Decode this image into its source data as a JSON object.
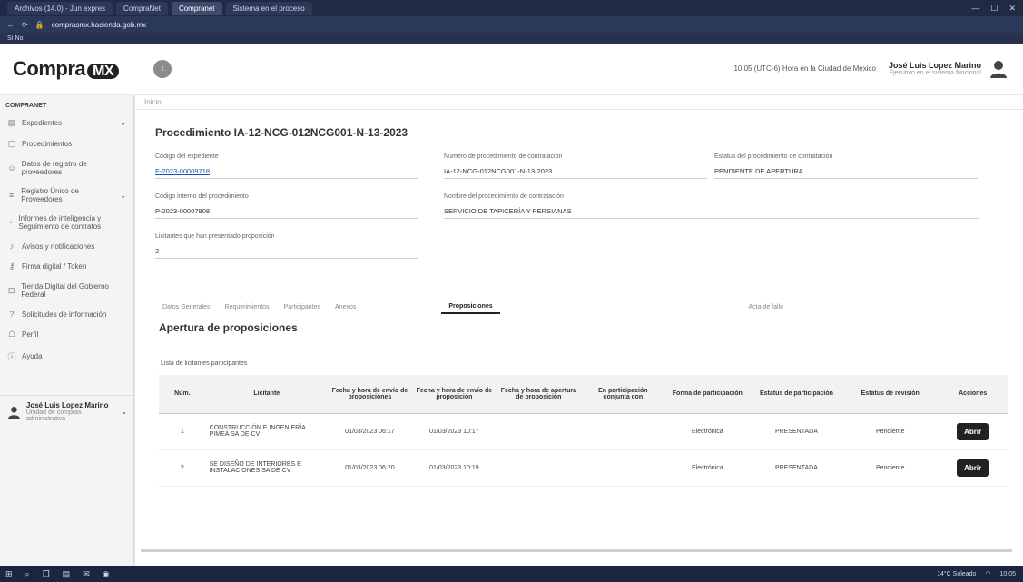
{
  "browser": {
    "tabs": [
      "Archivos (14.0) - Jun expres",
      "CompraNet",
      "Compranet",
      "Sistema en el proceso"
    ],
    "url": "comprasmx.hacienda.gob.mx",
    "bookmarks": "Sí No"
  },
  "header": {
    "logo_text": "Compra",
    "logo_badge": "MX",
    "time_notice": "10:05 (UTC-6) Hora en la Ciudad de México",
    "user_name": "José Luis Lopez Marino",
    "user_role": "Ejecutivo en el sistema funcional"
  },
  "sidebar": {
    "section": "COMPRANET",
    "items": [
      {
        "label": "Expedientes",
        "icon": "folder-icon",
        "chevron": true
      },
      {
        "label": "Procedimientos",
        "icon": "document-icon"
      },
      {
        "label": "Datos de registro de proveedores",
        "icon": "user-icon"
      },
      {
        "label": "Registro Único de Proveedores",
        "icon": "list-icon",
        "chevron": true
      },
      {
        "label": "Informes de inteligencia y Seguimiento de contratos",
        "icon": "chart-icon"
      },
      {
        "label": "Avisos y notificaciones",
        "icon": "bell-icon"
      },
      {
        "label": "Firma digital / Token",
        "icon": "key-icon"
      },
      {
        "label": "Tienda Digital del Gobierno Federal",
        "icon": "cart-icon"
      },
      {
        "label": "Solicitudes de información",
        "icon": "question-icon"
      },
      {
        "label": "Perfil",
        "icon": "profile-icon"
      },
      {
        "label": "Ayuda",
        "icon": "help-icon"
      }
    ],
    "user_name": "José Luis Lopez Marino",
    "user_role": "Unidad de compras administrativa"
  },
  "main": {
    "breadcrumb": "Inicio",
    "procedure_title": "Procedimiento IA-12-NCG-012NCG001-N-13-2023",
    "fields": {
      "codigo_expediente_label": "Código del expediente",
      "codigo_expediente_value": "E-2023-00009718",
      "numero_procedimiento_label": "Número de procedimiento de contratación",
      "numero_procedimiento_value": "IA-12-NCG-012NCG001-N-13-2023",
      "estatus_label": "Estatus del procedimiento de contratación",
      "estatus_value": "PENDIENTE DE APERTURA",
      "codigo_interno_label": "Código interno del procedimiento",
      "codigo_interno_value": "P-2023-00007908",
      "nombre_procedimiento_label": "Nombre del procedimiento de contratación",
      "nombre_procedimiento_value": "SERVICIO DE TAPICERÍA Y PERSIANAS",
      "licitantes_label": "Licitantes que han presentado proposición",
      "licitantes_value": "2"
    },
    "tabs": [
      "Datos Generales",
      "Requerimientos",
      "Participantes",
      "Anexos",
      "Proposiciones",
      "Acta de fallo"
    ],
    "active_tab": "Proposiciones",
    "section_title": "Apertura de proposiciones",
    "list_title": "Lista de licitantes participantes",
    "table": {
      "headers": [
        "Núm.",
        "Licitante",
        "Fecha y hora de envío de proposiciones",
        "Fecha y hora de envío de proposición",
        "Fecha y hora de apertura de proposición",
        "En participación conjunta con",
        "Forma de participación",
        "Estatus de participación",
        "Estatus de revisión",
        "Acciones"
      ],
      "rows": [
        {
          "num": "1",
          "licitante": "CONSTRUCCIÓN E INGENIERÍA PIMEA SA DE CV",
          "fecha_envio": "01/03/2023 06:17",
          "fecha_envio2": "01/03/2023 10:17",
          "fecha_apertura": "",
          "conjunta": "",
          "forma": "Electrónica",
          "estatus": "PRESENTADA",
          "revision": "Pendiente",
          "accion": "Abrir"
        },
        {
          "num": "2",
          "licitante": "SE DISEÑO DE INTERIORES E INSTALACIONES SA DE CV",
          "fecha_envio": "01/03/2023 06:20",
          "fecha_envio2": "01/03/2023 10:19",
          "fecha_apertura": "",
          "conjunta": "",
          "forma": "Electrónica",
          "estatus": "PRESENTADA",
          "revision": "Pendiente",
          "accion": "Abrir"
        }
      ]
    }
  },
  "taskbar": {
    "clock": "10:05",
    "tray_text": "14°C Soleado"
  }
}
